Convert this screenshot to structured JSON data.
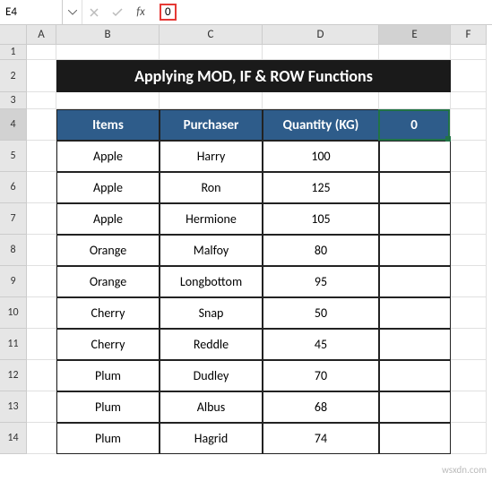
{
  "formula_bar": {
    "name_box": "E4",
    "formula_value": "0"
  },
  "columns": [
    "A",
    "B",
    "C",
    "D",
    "E",
    "F"
  ],
  "rows": [
    "1",
    "2",
    "3",
    "4",
    "5",
    "6",
    "7",
    "8",
    "9",
    "10",
    "11",
    "12",
    "13",
    "14"
  ],
  "title": "Applying MOD, IF & ROW Functions",
  "headers": {
    "items": "Items",
    "purchaser": "Purchaser",
    "quantity": "Quantity (KG)"
  },
  "selected_value": "0",
  "data": [
    {
      "item": "Apple",
      "purchaser": "Harry",
      "qty": "100"
    },
    {
      "item": "Apple",
      "purchaser": "Ron",
      "qty": "125"
    },
    {
      "item": "Apple",
      "purchaser": "Hermione",
      "qty": "105"
    },
    {
      "item": "Orange",
      "purchaser": "Malfoy",
      "qty": "80"
    },
    {
      "item": "Orange",
      "purchaser": "Longbottom",
      "qty": "95"
    },
    {
      "item": "Cherry",
      "purchaser": "Snap",
      "qty": "50"
    },
    {
      "item": "Cherry",
      "purchaser": "Reddle",
      "qty": "45"
    },
    {
      "item": "Plum",
      "purchaser": "Dudley",
      "qty": "70"
    },
    {
      "item": "Plum",
      "purchaser": "Albus",
      "qty": "68"
    },
    {
      "item": "Plum",
      "purchaser": "Hagrid",
      "qty": "74"
    }
  ],
  "watermark": "wsxdn.com",
  "active_column": 4,
  "active_row": 3
}
